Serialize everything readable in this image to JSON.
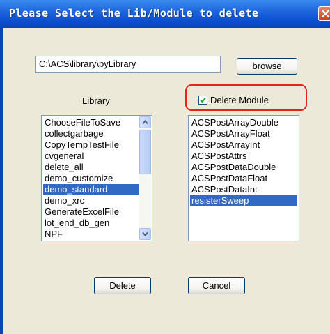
{
  "window": {
    "title": "Please Select the Lib/Module to delete"
  },
  "path": {
    "value": "C:\\ACS\\library\\pyLibrary"
  },
  "buttons": {
    "browse": "browse",
    "delete": "Delete",
    "cancel": "Cancel"
  },
  "library": {
    "label": "Library",
    "items": [
      "ChooseFileToSave",
      "collectgarbage",
      "CopyTempTestFile",
      "cvgeneral",
      "delete_all",
      "demo_customize",
      "demo_standard",
      "demo_xrc",
      "GenerateExcelFile",
      "lot_end_db_gen",
      "NPF"
    ],
    "selected": "demo_standard"
  },
  "module": {
    "checkbox_label": "Delete Module",
    "checked": true,
    "items": [
      "ACSPostArrayDouble",
      "ACSPostArrayFloat",
      "ACSPostArrayInt",
      "ACSPostAttrs",
      "ACSPostDataDouble",
      "ACSPostDataFloat",
      "ACSPostDataInt",
      "resisterSweep"
    ],
    "selected": "resisterSweep"
  },
  "icons": {
    "close": "close-icon",
    "check": "check-icon",
    "scroll_up": "arrow-up-icon",
    "scroll_down": "arrow-down-icon"
  },
  "colors": {
    "titlebar": "#0a46b8",
    "selection": "#316ac5",
    "highlight_annotation": "#e8221b",
    "dialog_bg": "#ece9d8"
  }
}
